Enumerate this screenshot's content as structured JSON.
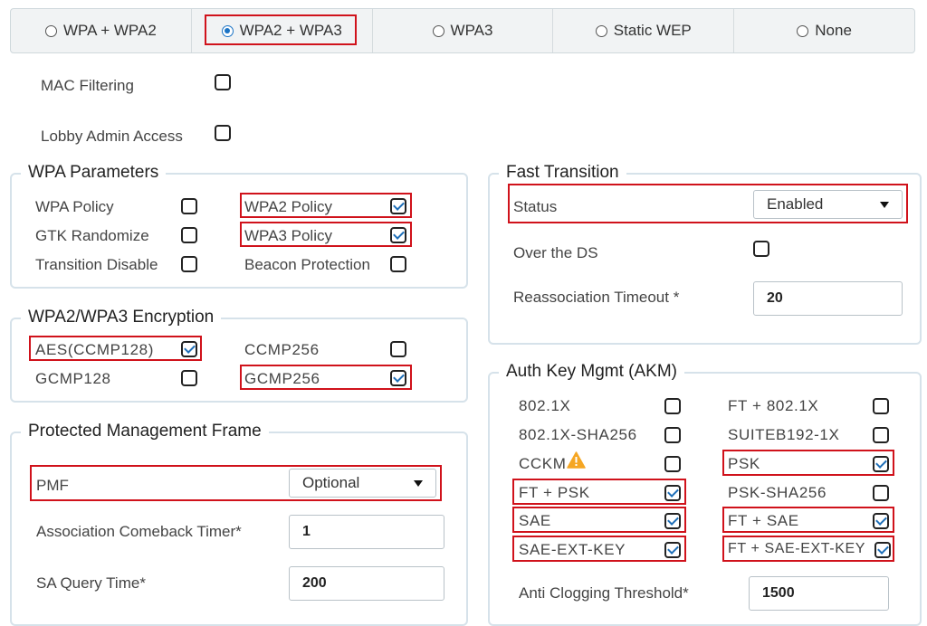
{
  "security_tabs": [
    {
      "label": "WPA + WPA2",
      "selected": false
    },
    {
      "label": "WPA2 + WPA3",
      "selected": true
    },
    {
      "label": "WPA3",
      "selected": false
    },
    {
      "label": "Static WEP",
      "selected": false
    },
    {
      "label": "None",
      "selected": false
    }
  ],
  "general": {
    "mac_filtering": {
      "label": "MAC Filtering",
      "checked": false
    },
    "lobby_admin": {
      "label": "Lobby Admin Access",
      "checked": false
    }
  },
  "wpa_params": {
    "title": "WPA Parameters",
    "wpa_policy": {
      "label": "WPA Policy",
      "checked": false
    },
    "wpa2_policy": {
      "label": "WPA2 Policy",
      "checked": true
    },
    "gtk_randomize": {
      "label": "GTK Randomize",
      "checked": false
    },
    "wpa3_policy": {
      "label": "WPA3 Policy",
      "checked": true
    },
    "transition_disable": {
      "label": "Transition Disable",
      "checked": false
    },
    "beacon_protection": {
      "label": "Beacon Protection",
      "checked": false
    }
  },
  "encryption": {
    "title": "WPA2/WPA3 Encryption",
    "aes": {
      "label": "AES(CCMP128)",
      "checked": true
    },
    "ccmp256": {
      "label": "CCMP256",
      "checked": false
    },
    "gcmp128": {
      "label": "GCMP128",
      "checked": false
    },
    "gcmp256": {
      "label": "GCMP256",
      "checked": true
    }
  },
  "pmf": {
    "title": "Protected Management Frame",
    "pmf_label": "PMF",
    "pmf_value": "Optional",
    "comeback_label": "Association Comeback Timer*",
    "comeback_value": "1",
    "sa_query_label": "SA Query Time*",
    "sa_query_value": "200"
  },
  "fast_transition": {
    "title": "Fast Transition",
    "status_label": "Status",
    "status_value": "Enabled",
    "over_ds": {
      "label": "Over the DS",
      "checked": false
    },
    "reassoc_label": "Reassociation Timeout *",
    "reassoc_value": "20"
  },
  "akm": {
    "title": "Auth Key Mgmt (AKM)",
    "items": [
      {
        "label": "802.1X",
        "checked": false
      },
      {
        "label": "FT + 802.1X",
        "checked": false
      },
      {
        "label": "802.1X-SHA256",
        "checked": false
      },
      {
        "label": "SUITEB192-1X",
        "checked": false
      },
      {
        "label": "CCKM",
        "checked": false,
        "warning": "warning-icon"
      },
      {
        "label": "PSK",
        "checked": true
      },
      {
        "label": "FT + PSK",
        "checked": true
      },
      {
        "label": "PSK-SHA256",
        "checked": false
      },
      {
        "label": "SAE",
        "checked": true
      },
      {
        "label": "FT + SAE",
        "checked": true
      },
      {
        "label": "SAE-EXT-KEY",
        "checked": true
      },
      {
        "label": "FT + SAE-EXT-KEY",
        "checked": true
      }
    ],
    "anti_clogging_label": "Anti Clogging Threshold*",
    "anti_clogging_value": "1500"
  },
  "colors": {
    "accent": "#1a73c5",
    "highlight": "#d0121b",
    "warning": "#f5a623"
  }
}
